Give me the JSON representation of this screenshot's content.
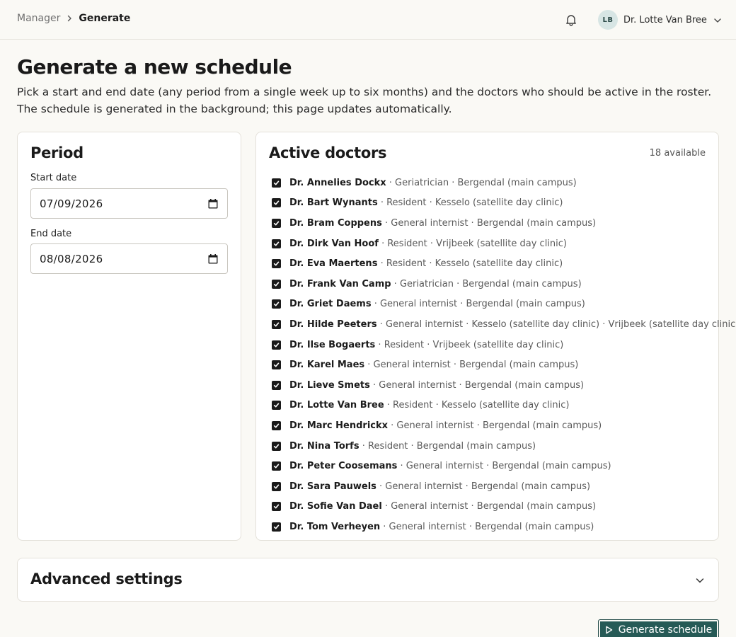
{
  "breadcrumb": {
    "parent": "Manager",
    "current": "Generate"
  },
  "user": {
    "initials": "LB",
    "name": "Dr. Lotte Van Bree"
  },
  "page": {
    "title": "Generate a new schedule",
    "description": "Pick a start and end date (any period from a single week up to six months) and the doctors who should be active in the roster. The schedule is generated in the background; this page updates automatically."
  },
  "period": {
    "title": "Period",
    "start_label": "Start date",
    "start_value": "07/09/2026",
    "end_label": "End date",
    "end_value": "08/08/2026"
  },
  "doctors": {
    "title": "Active doctors",
    "available": "18 available",
    "list": [
      {
        "name": "Dr. Annelies Dockx",
        "details": " · Geriatrician · Bergendal (main campus)",
        "checked": true
      },
      {
        "name": "Dr. Bart Wynants",
        "details": " · Resident · Kesselo (satellite day clinic)",
        "checked": true
      },
      {
        "name": "Dr. Bram Coppens",
        "details": " · General internist · Bergendal (main campus)",
        "checked": true
      },
      {
        "name": "Dr. Dirk Van Hoof",
        "details": " · Resident · Vrijbeek (satellite day clinic)",
        "checked": true
      },
      {
        "name": "Dr. Eva Maertens",
        "details": " · Resident · Kesselo (satellite day clinic)",
        "checked": true
      },
      {
        "name": "Dr. Frank Van Camp",
        "details": " · Geriatrician · Bergendal (main campus)",
        "checked": true
      },
      {
        "name": "Dr. Griet Daems",
        "details": " · General internist · Bergendal (main campus)",
        "checked": true
      },
      {
        "name": "Dr. Hilde Peeters",
        "details": " · General internist · Kesselo (satellite day clinic) · Vrijbeek (satellite day clinic)",
        "checked": true
      },
      {
        "name": "Dr. Ilse Bogaerts",
        "details": " · Resident · Vrijbeek (satellite day clinic)",
        "checked": true
      },
      {
        "name": "Dr. Karel Maes",
        "details": " · General internist · Bergendal (main campus)",
        "checked": true
      },
      {
        "name": "Dr. Lieve Smets",
        "details": " · General internist · Bergendal (main campus)",
        "checked": true
      },
      {
        "name": "Dr. Lotte Van Bree",
        "details": " · Resident · Kesselo (satellite day clinic)",
        "checked": true
      },
      {
        "name": "Dr. Marc Hendrickx",
        "details": " · General internist · Bergendal (main campus)",
        "checked": true
      },
      {
        "name": "Dr. Nina Torfs",
        "details": " · Resident · Bergendal (main campus)",
        "checked": true
      },
      {
        "name": "Dr. Peter Coosemans",
        "details": " · General internist · Bergendal (main campus)",
        "checked": true
      },
      {
        "name": "Dr. Sara Pauwels",
        "details": " · General internist · Bergendal (main campus)",
        "checked": true
      },
      {
        "name": "Dr. Sofie Van Dael",
        "details": " · General internist · Bergendal (main campus)",
        "checked": true
      },
      {
        "name": "Dr. Tom Verheyen",
        "details": " · General internist · Bergendal (main campus)",
        "checked": true
      }
    ]
  },
  "advanced": {
    "title": "Advanced settings"
  },
  "actions": {
    "generate_label": "Generate schedule"
  },
  "icons": {
    "breadcrumb_separator": "chevron-right-icon",
    "notifications": "bell-icon",
    "user_menu": "chevron-down-icon",
    "date_picker": "calendar-icon",
    "checkbox": "check-icon",
    "advanced_toggle": "chevron-down-icon",
    "generate": "play-icon"
  },
  "colors": {
    "accent": "#265a56",
    "avatar_bg": "#d7e5e4",
    "page_bg": "#faf9f5"
  }
}
